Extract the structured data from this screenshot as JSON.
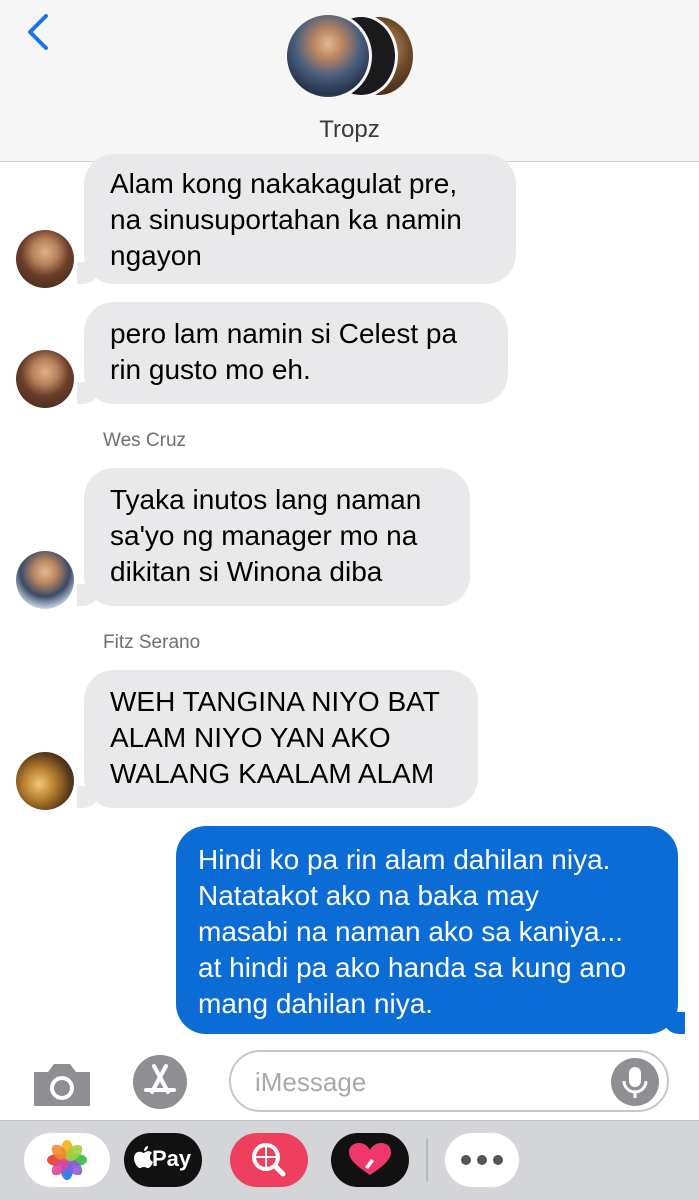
{
  "header": {
    "title": "Tropz",
    "back_icon": "chevron-left-icon",
    "accent_color": "#1a73e8"
  },
  "messages": [
    {
      "direction": "incoming",
      "sender": "",
      "lines": [
        "Alam kong nakakagulat pre,",
        "na sinusuportahan ka namin",
        "ngayon"
      ]
    },
    {
      "direction": "incoming",
      "sender": "",
      "lines": [
        "pero lam namin si Celest pa",
        "rin gusto mo eh."
      ]
    },
    {
      "direction": "incoming",
      "sender": "Wes Cruz",
      "lines": [
        "Tyaka inutos lang naman",
        "sa'yo ng manager mo na",
        "dikitan si Winona diba"
      ]
    },
    {
      "direction": "incoming",
      "sender": "Fitz Serano",
      "lines": [
        "WEH TANGINA NIYO BAT",
        "ALAM NIYO YAN AKO",
        "WALANG KAALAM ALAM"
      ]
    },
    {
      "direction": "outgoing",
      "sender": "",
      "lines": [
        "Hindi ko pa rin alam dahilan niya.",
        "Natatakot ako na baka may",
        "masabi na naman ako sa kaniya...",
        "at hindi pa ako handa sa kung ano",
        "mang dahilan niya."
      ]
    }
  ],
  "compose": {
    "placeholder": "iMessage",
    "camera_icon": "camera-icon",
    "appstore_icon": "app-store-icon",
    "mic_icon": "microphone-icon"
  },
  "app_drawer": {
    "apple_pay_label": "Pay",
    "apps": [
      "photos-icon",
      "apple-pay-icon",
      "image-search-icon",
      "digital-touch-icon",
      "more-icon"
    ]
  },
  "colors": {
    "incoming_bubble": "#e9e9eb",
    "outgoing_bubble": "#0b6cd6",
    "header_bg": "#f6f6f7",
    "drawer_bg": "#d4d5d9"
  }
}
